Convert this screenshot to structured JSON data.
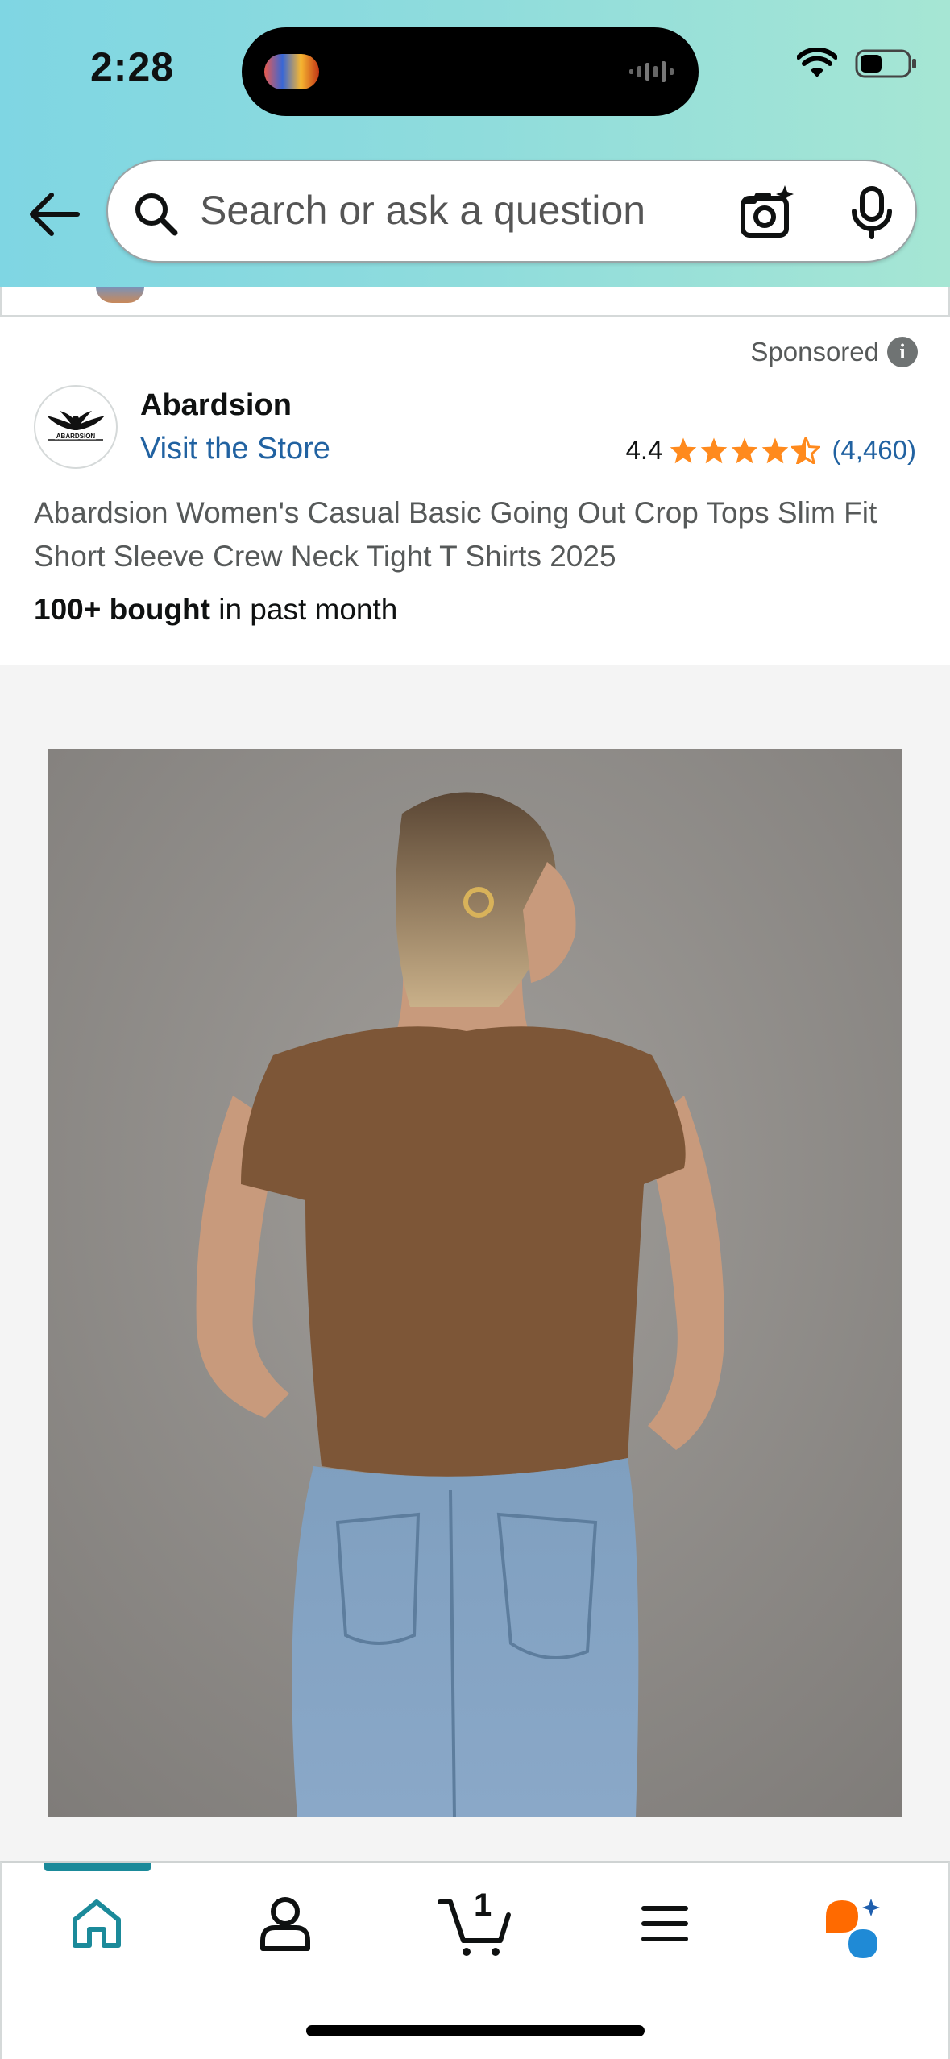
{
  "status_bar": {
    "time": "2:28"
  },
  "search": {
    "placeholder": "Search or ask a question"
  },
  "ad": {
    "sponsored_label": "Sponsored",
    "brand_name": "Abardsion",
    "logo_text": "ABARDSION",
    "visit_store": "Visit the Store",
    "rating": "4.4",
    "rating_count": "(4,460)",
    "stars_value": 4.4,
    "title": "Abardsion Women's Casual Basic Going Out Crop Tops Slim Fit Short Sleeve Crew Neck Tight T Shirts 2025",
    "bought_bold": "100+ bought",
    "bought_rest": " in past month"
  },
  "bottom_nav": {
    "cart_count": "1",
    "items": [
      "home-icon",
      "account-icon",
      "cart-icon",
      "menu-icon",
      "rufus-ai-icon"
    ],
    "active": "home"
  },
  "colors": {
    "header_gradient": [
      "#7fd6e3",
      "#a6e6d4"
    ],
    "link": "#2162a1",
    "star": "#ff8a1d",
    "active_tab": "#1b8a9a"
  }
}
